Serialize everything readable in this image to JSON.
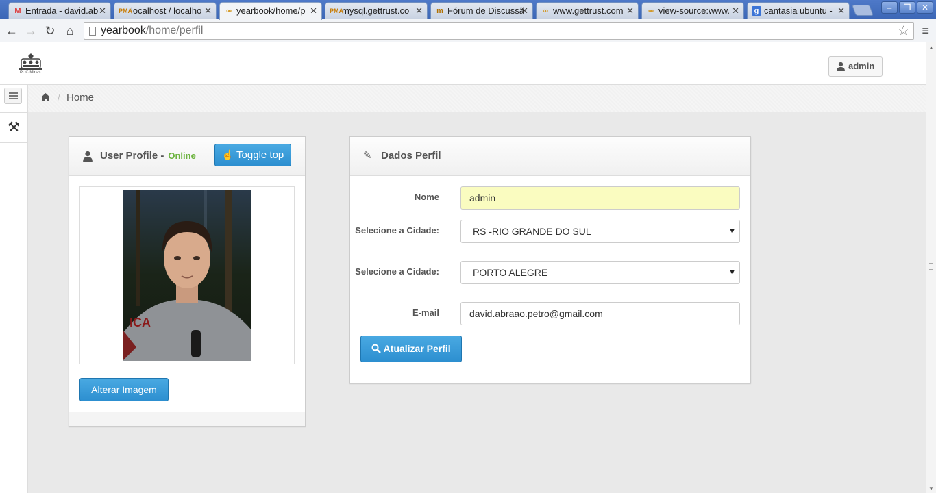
{
  "browser": {
    "tabs": [
      {
        "label": "Entrada - david.ab",
        "icon": "gmail-icon"
      },
      {
        "label": "localhost / localho",
        "icon": "phpmyadmin-icon"
      },
      {
        "label": "yearbook/home/p",
        "icon": "moodle-icon",
        "active": true
      },
      {
        "label": "mysql.gettrust.co",
        "icon": "phpmyadmin-icon"
      },
      {
        "label": "Fórum de Discussã",
        "icon": "forum-icon"
      },
      {
        "label": "www.gettrust.com",
        "icon": "moodle-icon"
      },
      {
        "label": "view-source:www.",
        "icon": "moodle-icon"
      },
      {
        "label": "cantasia ubuntu - ",
        "icon": "google-icon"
      }
    ],
    "url_host": "yearbook",
    "url_path": "/home/perfil"
  },
  "header": {
    "logo_text": "PUC Minas",
    "user_button": "admin"
  },
  "breadcrumb": {
    "home_label": "Home"
  },
  "profile_box": {
    "title": "User Profile -",
    "status": "Online",
    "toggle_button": "Toggle top",
    "change_image_button": "Alterar Imagem"
  },
  "form_box": {
    "title": "Dados Perfil",
    "fields": {
      "nome_label": "Nome",
      "nome_value": "admin",
      "estado_label": "Selecione a Cidade:",
      "estado_value": "RS -RIO GRANDE DO SUL",
      "cidade_label": "Selecione a Cidade:",
      "cidade_value": "PORTO ALEGRE",
      "email_label": "E-mail",
      "email_value": "david.abraao.petro@gmail.com"
    },
    "submit_button": "Atualizar Perfil"
  },
  "colors": {
    "primary_button": "#2d8fd0",
    "online": "#6cb33e",
    "highlight_input": "#fafcc0"
  }
}
